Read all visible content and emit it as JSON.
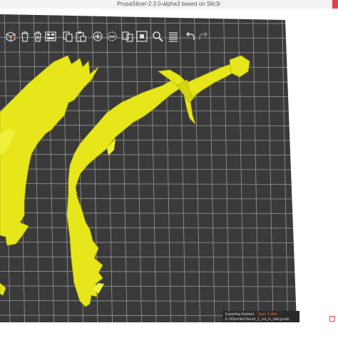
{
  "window": {
    "title": "PrusaSlicer-2.3.0-alpha3 based on Slic3r"
  },
  "toolbar": {
    "buttons": [
      {
        "name": "add-icon"
      },
      {
        "name": "delete-icon"
      },
      {
        "name": "delete-all-icon"
      },
      {
        "name": "arrange-icon"
      },
      {
        "name": "copy-icon"
      },
      {
        "name": "paste-icon"
      },
      {
        "name": "add-instance-icon"
      },
      {
        "name": "remove-instance-icon"
      },
      {
        "name": "split-objects-icon"
      },
      {
        "name": "split-parts-icon"
      },
      {
        "name": "search-icon"
      },
      {
        "name": "layers-icon"
      },
      {
        "name": "undo-icon"
      },
      {
        "name": "redo-icon"
      }
    ]
  },
  "notification": {
    "message": "Exporting finished.",
    "link": "Open Folder.",
    "path": "E:\\3Dprinter\\Sword_2_cut_in_half.gcode"
  },
  "colors": {
    "bed": "#3a3a3a",
    "grid": "#9a9a9a",
    "model": "#e6e61a",
    "model_edge": "#c8c800",
    "accent": "#ed6b21"
  }
}
